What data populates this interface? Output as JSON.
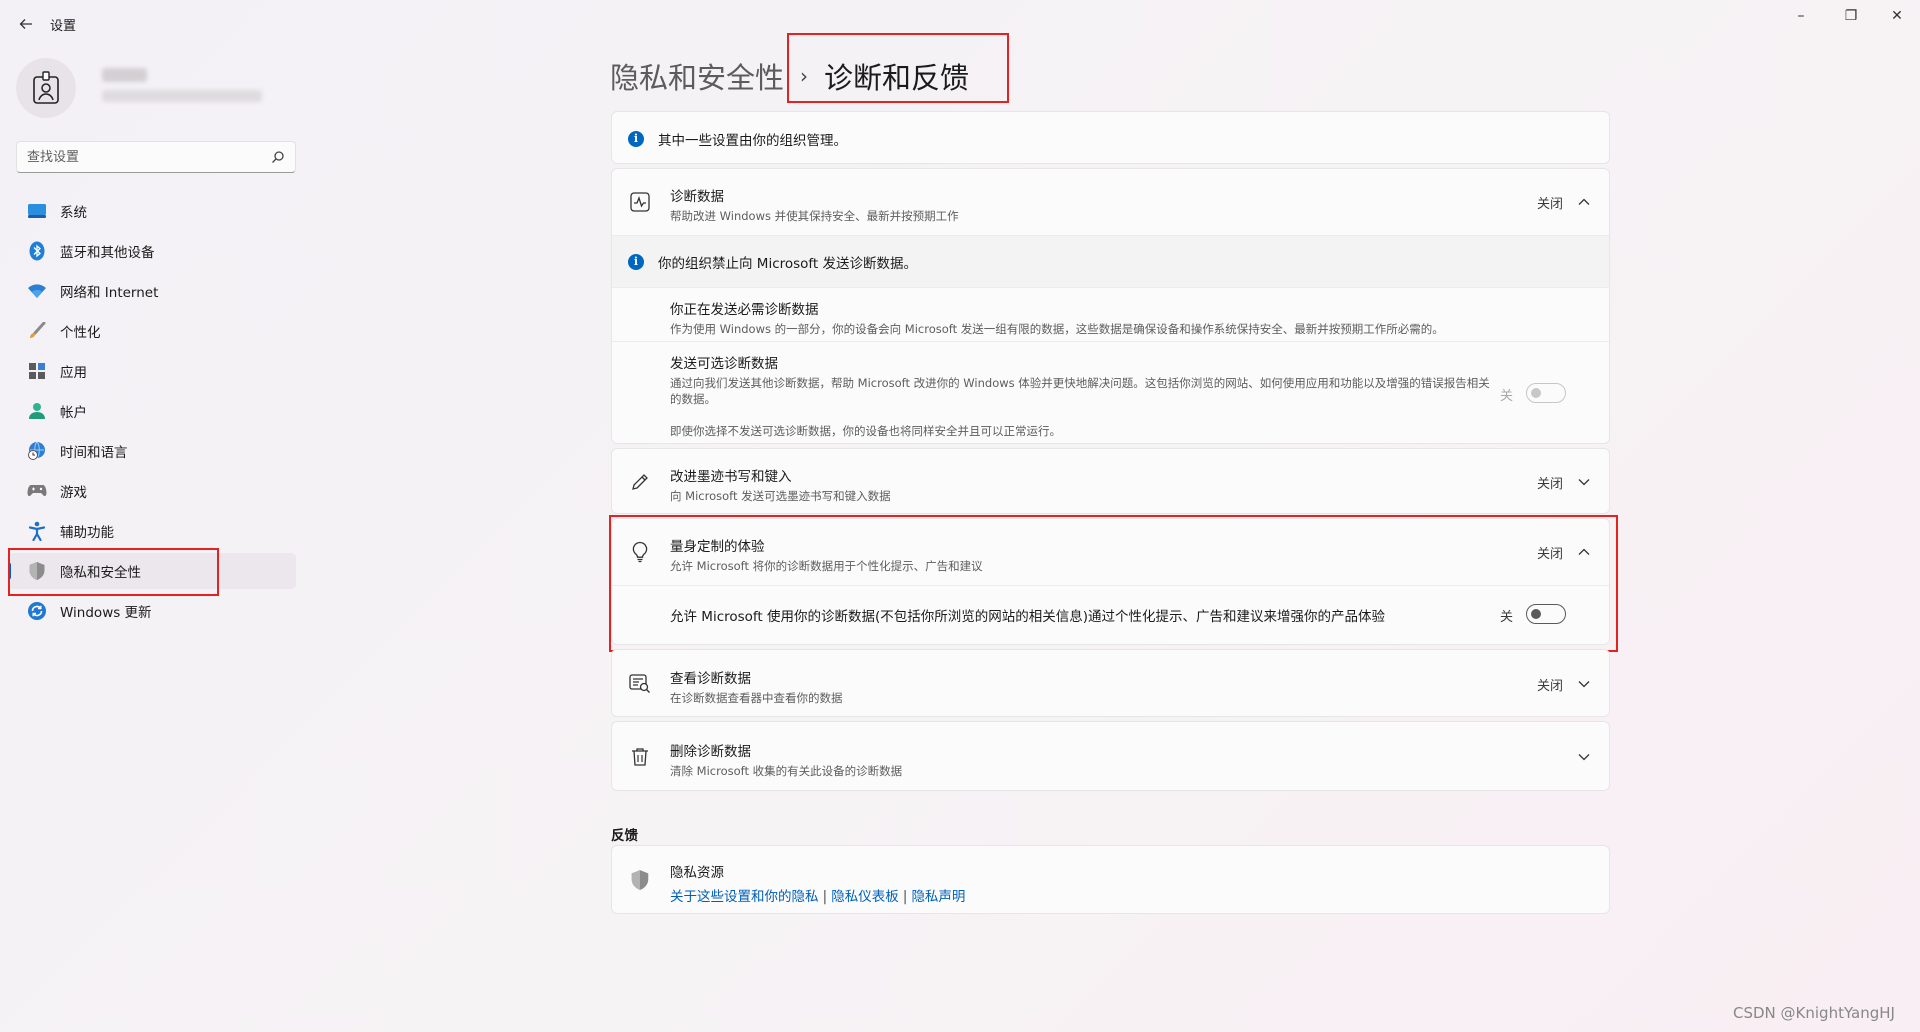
{
  "window": {
    "title": "设置",
    "controls": {
      "minimize": "–",
      "maximize": "❐",
      "close": "✕"
    }
  },
  "search": {
    "placeholder": "查找设置"
  },
  "sidebar": {
    "items": [
      {
        "label": "系统",
        "icon": "system-monitor-icon"
      },
      {
        "label": "蓝牙和其他设备",
        "icon": "bluetooth-icon"
      },
      {
        "label": "网络和 Internet",
        "icon": "wifi-icon"
      },
      {
        "label": "个性化",
        "icon": "paintbrush-icon"
      },
      {
        "label": "应用",
        "icon": "apps-icon"
      },
      {
        "label": "帐户",
        "icon": "account-icon"
      },
      {
        "label": "时间和语言",
        "icon": "globe-clock-icon"
      },
      {
        "label": "游戏",
        "icon": "gamepad-icon"
      },
      {
        "label": "辅助功能",
        "icon": "accessibility-icon"
      },
      {
        "label": "隐私和安全性",
        "icon": "shield-icon",
        "active": true
      },
      {
        "label": "Windows 更新",
        "icon": "update-icon"
      }
    ]
  },
  "breadcrumb": {
    "parent": "隐私和安全性",
    "separator": "›",
    "current": "诊断和反馈"
  },
  "org_notice": "其中一些设置由你的组织管理。",
  "diagnostic": {
    "title": "诊断数据",
    "desc": "帮助改进 Windows 并使其保持安全、最新并按预期工作",
    "status": "关闭",
    "org_block_notice": "你的组织禁止向 Microsoft 发送诊断数据。",
    "required": {
      "title": "你正在发送必需诊断数据",
      "desc": "作为使用 Windows 的一部分，你的设备会向 Microsoft 发送一组有限的数据，这些数据是确保设备和操作系统保持安全、最新并按预期工作所必需的。"
    },
    "optional": {
      "title": "发送可选诊断数据",
      "desc": "通过向我们发送其他诊断数据，帮助 Microsoft 改进你的 Windows 体验并更快地解决问题。这包括你浏览的网站、如何使用应用和功能以及增强的错误报告相关的数据。",
      "toggle_label": "关",
      "footer": "即使你选择不发送可选诊断数据，你的设备也将同样安全并且可以正常运行。"
    }
  },
  "inking": {
    "title": "改进墨迹书写和键入",
    "desc": "向 Microsoft 发送可选墨迹书写和键入数据",
    "status": "关闭"
  },
  "tailored": {
    "title": "量身定制的体验",
    "desc": "允许 Microsoft 将你的诊断数据用于个性化提示、广告和建议",
    "status": "关闭",
    "option_text": "允许 Microsoft 使用你的诊断数据(不包括你所浏览的网站的相关信息)通过个性化提示、广告和建议来增强你的产品体验",
    "toggle_label": "关"
  },
  "viewer": {
    "title": "查看诊断数据",
    "desc": "在诊断数据查看器中查看你的数据",
    "status": "关闭"
  },
  "delete": {
    "title": "删除诊断数据",
    "desc": "清除 Microsoft 收集的有关此设备的诊断数据"
  },
  "feedback": {
    "heading": "反馈",
    "privacy_resources": {
      "title": "隐私资源",
      "links": [
        "关于这些设置和你的隐私",
        "隐私仪表板",
        "隐私声明"
      ],
      "separator": "|"
    }
  },
  "watermark": "CSDN @KnightYangHJ",
  "colors": {
    "accent": "#005fb8",
    "highlight_box": "#e32222",
    "info": "#0067c0"
  }
}
